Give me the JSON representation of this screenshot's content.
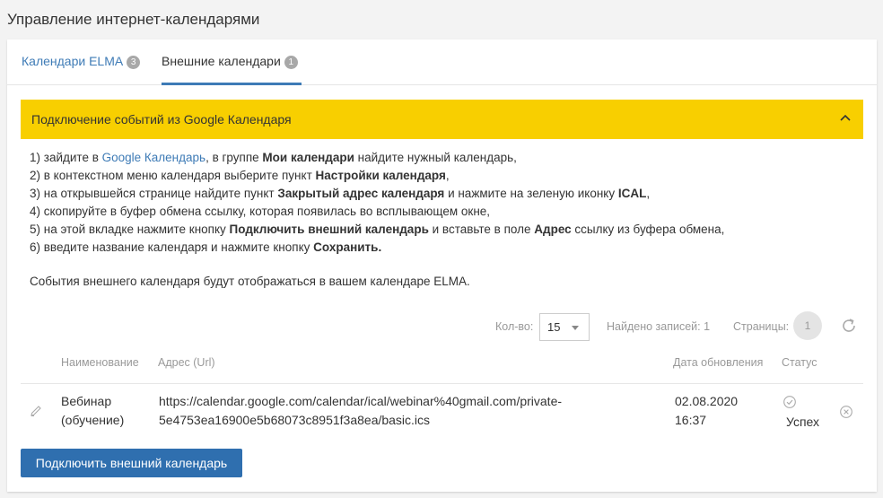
{
  "page": {
    "title": "Управление интернет-календарями"
  },
  "tabs": [
    {
      "label": "Календари ELMA",
      "count": "3"
    },
    {
      "label": "Внешние календари",
      "count": "1"
    }
  ],
  "banner": {
    "title": "Подключение событий из Google Календаря"
  },
  "instructions": {
    "l1_a": "1) зайдите в ",
    "l1_link": "Google Календарь",
    "l1_b": ", в группе ",
    "l1_bold": "Мои календари",
    "l1_c": " найдите нужный календарь,",
    "l2_a": "2) в контекстном меню календаря выберите пункт ",
    "l2_bold": "Настройки календаря",
    "l2_b": ",",
    "l3_a": "3) на открывшейся странице найдите пункт ",
    "l3_bold": "Закрытый адрес календаря",
    "l3_b": " и нажмите на зеленую иконку ",
    "l3_bold2": "ICAL",
    "l3_c": ",",
    "l4": "4) скопируйте в буфер обмена ссылку, которая появилась во всплывающем окне,",
    "l5_a": "5) на этой вкладке нажмите кнопку ",
    "l5_bold": "Подключить внешний календарь",
    "l5_b": " и вставьте в поле ",
    "l5_bold2": "Адрес",
    "l5_c": " ссылку из буфера обмена,",
    "l6_a": "6) введите название календаря и нажмите кнопку ",
    "l6_bold": "Сохранить.",
    "note": "События внешнего календаря будут отображаться в вашем календаре ELMA."
  },
  "pager": {
    "count_label": "Кол-во:",
    "count_value": "15",
    "found_label": "Найдено записей: 1",
    "pages_label": "Страницы:",
    "current_page": "1"
  },
  "table": {
    "headers": {
      "name": "Наименование",
      "url": "Адрес (Url)",
      "updated": "Дата обновления",
      "status": "Статус"
    },
    "rows": [
      {
        "name_line1": "Вебинар",
        "name_line2": "(обучение)",
        "url_line1": "https://calendar.google.com/calendar/ical/webinar%40gmail.com/private-",
        "url_line2": "5e4753ea16900e5b68073c8951f3a8ea/basic.ics",
        "date": "02.08.2020",
        "time": "16:37",
        "status": "Успех"
      }
    ]
  },
  "actions": {
    "connect_label": "Подключить внешний календарь"
  },
  "colors": {
    "accent": "#3e7bb6",
    "banner": "#f8cf00",
    "button": "#2f6faf"
  },
  "icons": [
    "chevron-up-icon",
    "refresh-icon",
    "pencil-icon",
    "check-circle-icon",
    "close-circle-icon",
    "dropdown-caret-icon"
  ]
}
